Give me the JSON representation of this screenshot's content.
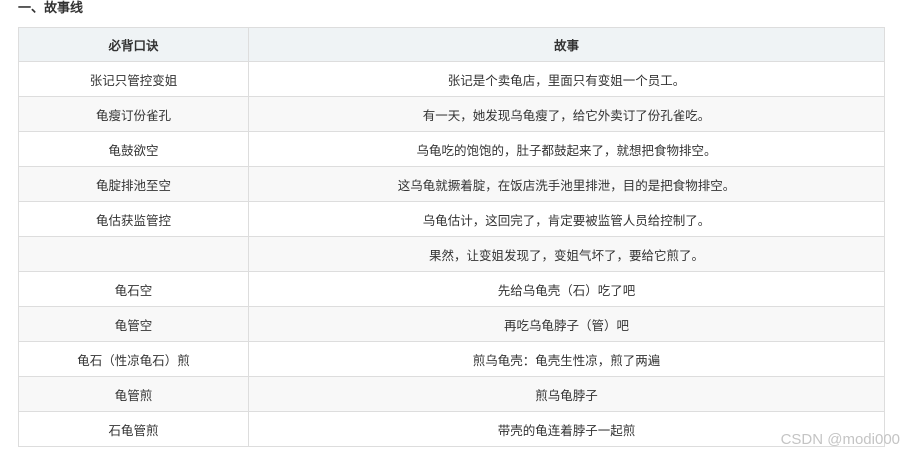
{
  "section_title": "一、故事线",
  "table": {
    "headers": [
      "必背口诀",
      "故事"
    ],
    "rows": [
      [
        "张记只管控变姐",
        "张记是个卖龟店，里面只有变姐一个员工。"
      ],
      [
        "龟瘦订份雀孔",
        "有一天，她发现乌龟瘦了，给它外卖订了份孔雀吃。"
      ],
      [
        "龟鼓欲空",
        "乌龟吃的饱饱的，肚子都鼓起来了，就想把食物排空。"
      ],
      [
        "龟腚排池至空",
        "这乌龟就撅着腚，在饭店洗手池里排泄，目的是把食物排空。"
      ],
      [
        "龟估获监管控",
        "乌龟估计，这回完了，肯定要被监管人员给控制了。"
      ],
      [
        "",
        "果然，让变姐发现了，变姐气坏了，要给它煎了。"
      ],
      [
        "龟石空",
        "先给乌龟壳（石）吃了吧"
      ],
      [
        "龟管空",
        "再吃乌龟脖子（管）吧"
      ],
      [
        "龟石（性凉龟石）煎",
        "煎乌龟壳：龟壳生性凉，煎了两遍"
      ],
      [
        "龟管煎",
        "煎乌龟脖子"
      ],
      [
        "石龟管煎",
        "带壳的龟连着脖子一起煎"
      ]
    ]
  },
  "watermark": "CSDN @modi000"
}
